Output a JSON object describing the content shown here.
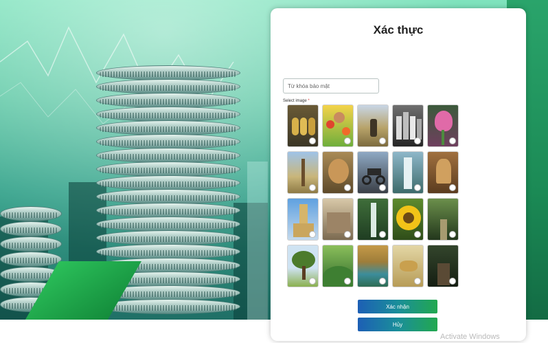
{
  "dialog": {
    "title": "Xác thực",
    "keyword_placeholder": "Từ khóa bảo mật",
    "select_label": "Select image",
    "required_mark": "*",
    "confirm_label": "Xác nhận",
    "cancel_label": "Hủy"
  },
  "images": [
    {
      "name": "image-golden-coins"
    },
    {
      "name": "image-child-flowers"
    },
    {
      "name": "image-farmer-field"
    },
    {
      "name": "image-bottles"
    },
    {
      "name": "image-pink-flower"
    },
    {
      "name": "image-dry-savanna"
    },
    {
      "name": "image-lion"
    },
    {
      "name": "image-motorbike"
    },
    {
      "name": "image-waterfall-cliff"
    },
    {
      "name": "image-temple-carving"
    },
    {
      "name": "image-palace-tower"
    },
    {
      "name": "image-ancient-ruins"
    },
    {
      "name": "image-forest-waterfall"
    },
    {
      "name": "image-sunflower"
    },
    {
      "name": "image-forest-path"
    },
    {
      "name": "image-lone-tree"
    },
    {
      "name": "image-green-hills"
    },
    {
      "name": "image-mountain-lake"
    },
    {
      "name": "image-cheetah"
    },
    {
      "name": "image-jungle-bridge"
    }
  ],
  "colors": {
    "button_gradient_start": "#1d5fb5",
    "button_gradient_end": "#22a84f",
    "background_green": "#5fc9a6"
  },
  "system": {
    "watermark": "Activate Windows"
  }
}
